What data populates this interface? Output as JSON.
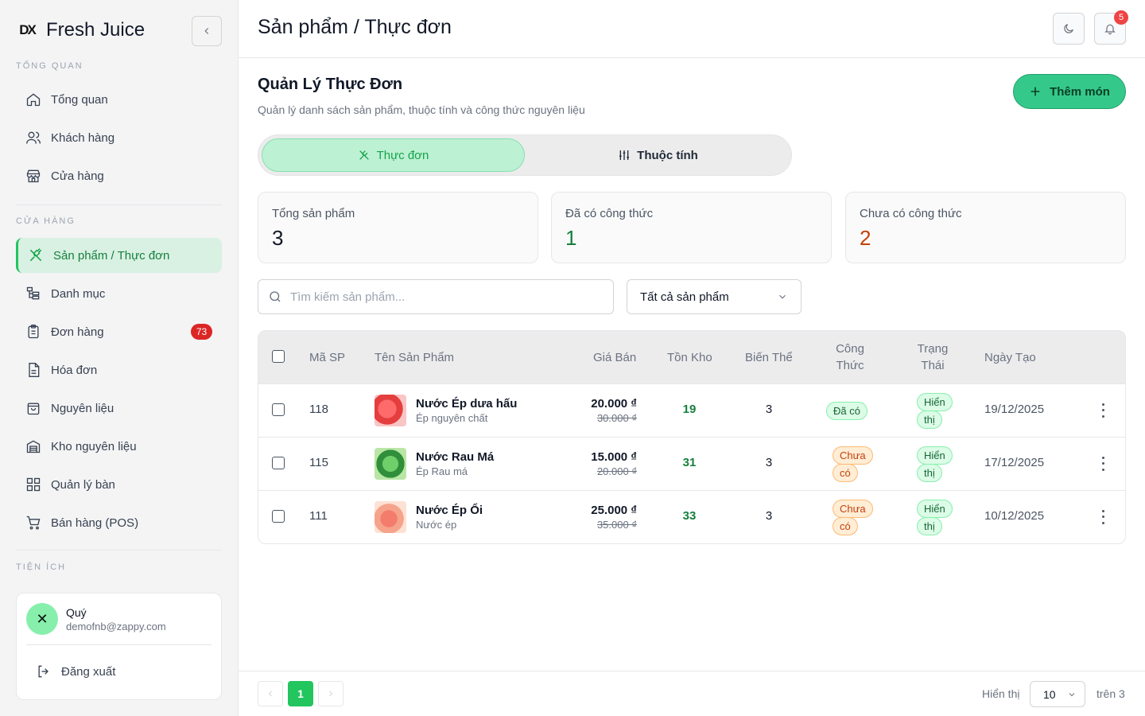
{
  "app": {
    "logo": "DX",
    "name": "Fresh Juice"
  },
  "sidebar": {
    "sections": {
      "overview": "TỔNG QUAN",
      "store": "CỬA HÀNG",
      "utilities": "TIỆN ÍCH"
    },
    "items": [
      {
        "label": "Tổng quan",
        "icon": "home-icon"
      },
      {
        "label": "Khách hàng",
        "icon": "users-icon"
      },
      {
        "label": "Cửa hàng",
        "icon": "store-icon"
      },
      {
        "label": "Sản phẩm / Thực đơn",
        "icon": "utensils-icon",
        "active": true
      },
      {
        "label": "Danh mục",
        "icon": "category-tree-icon"
      },
      {
        "label": "Đơn hàng",
        "icon": "clipboard-icon",
        "badge": "73"
      },
      {
        "label": "Hóa đơn",
        "icon": "invoice-icon"
      },
      {
        "label": "Nguyên liệu",
        "icon": "bag-icon"
      },
      {
        "label": "Kho nguyên liệu",
        "icon": "warehouse-icon"
      },
      {
        "label": "Quản lý bàn",
        "icon": "grid-icon"
      },
      {
        "label": "Bán hàng (POS)",
        "icon": "cart-icon"
      }
    ],
    "user": {
      "name": "Quý",
      "email": "demofnb@zappy.com",
      "logout": "Đăng xuất"
    }
  },
  "header": {
    "title": "Sản phẩm / Thực đơn",
    "notification_count": "5"
  },
  "main": {
    "title": "Quản Lý Thực Đơn",
    "subtitle": "Quản lý danh sách sản phẩm, thuộc tính và công thức nguyên liệu",
    "add_button": "Thêm món",
    "tabs": [
      {
        "label": "Thực đơn"
      },
      {
        "label": "Thuộc tính"
      }
    ],
    "stats": [
      {
        "label": "Tổng sản phẩm",
        "value": "3",
        "color": "#111827"
      },
      {
        "label": "Đã có công thức",
        "value": "1",
        "color": "#15803d"
      },
      {
        "label": "Chưa có công thức",
        "value": "2",
        "color": "#c2410c"
      }
    ],
    "search_placeholder": "Tìm kiếm sản phẩm...",
    "filter_value": "Tất cả sản phẩm"
  },
  "table": {
    "headers": {
      "code": "Mã SP",
      "name": "Tên Sản Phẩm",
      "price": "Giá Bán",
      "stock": "Tồn Kho",
      "variants": "Biến Thể",
      "recipe_1": "Công",
      "recipe_2": "Thức",
      "status_1": "Trạng",
      "status_2": "Thái",
      "created": "Ngày Tạo"
    },
    "rows": [
      {
        "code": "118",
        "name": "Nước Ép dưa hấu",
        "desc": "Ép nguyên chất",
        "price": "20.000 ₫",
        "old_price": "30.000 ₫",
        "stock": "19",
        "variants": "3",
        "recipe_1": "Đã có",
        "recipe_2": "",
        "status_1": "Hiển",
        "status_2": "thị",
        "created": "19/12/2025"
      },
      {
        "code": "115",
        "name": "Nước Rau Má",
        "desc": "Ép Rau má",
        "price": "15.000 ₫",
        "old_price": "20.000 ₫",
        "stock": "31",
        "variants": "3",
        "recipe_1": "Chưa",
        "recipe_2": "có",
        "status_1": "Hiển",
        "status_2": "thị",
        "created": "17/12/2025"
      },
      {
        "code": "111",
        "name": "Nước Ép Ổi",
        "desc": "Nước ép",
        "price": "25.000 ₫",
        "old_price": "35.000 ₫",
        "stock": "33",
        "variants": "3",
        "recipe_1": "Chưa",
        "recipe_2": "có",
        "status_1": "Hiển",
        "status_2": "thị",
        "created": "10/12/2025"
      }
    ]
  },
  "pagination": {
    "current": "1",
    "show_label": "Hiển thị",
    "page_size": "10",
    "total_label": "trên 3"
  }
}
